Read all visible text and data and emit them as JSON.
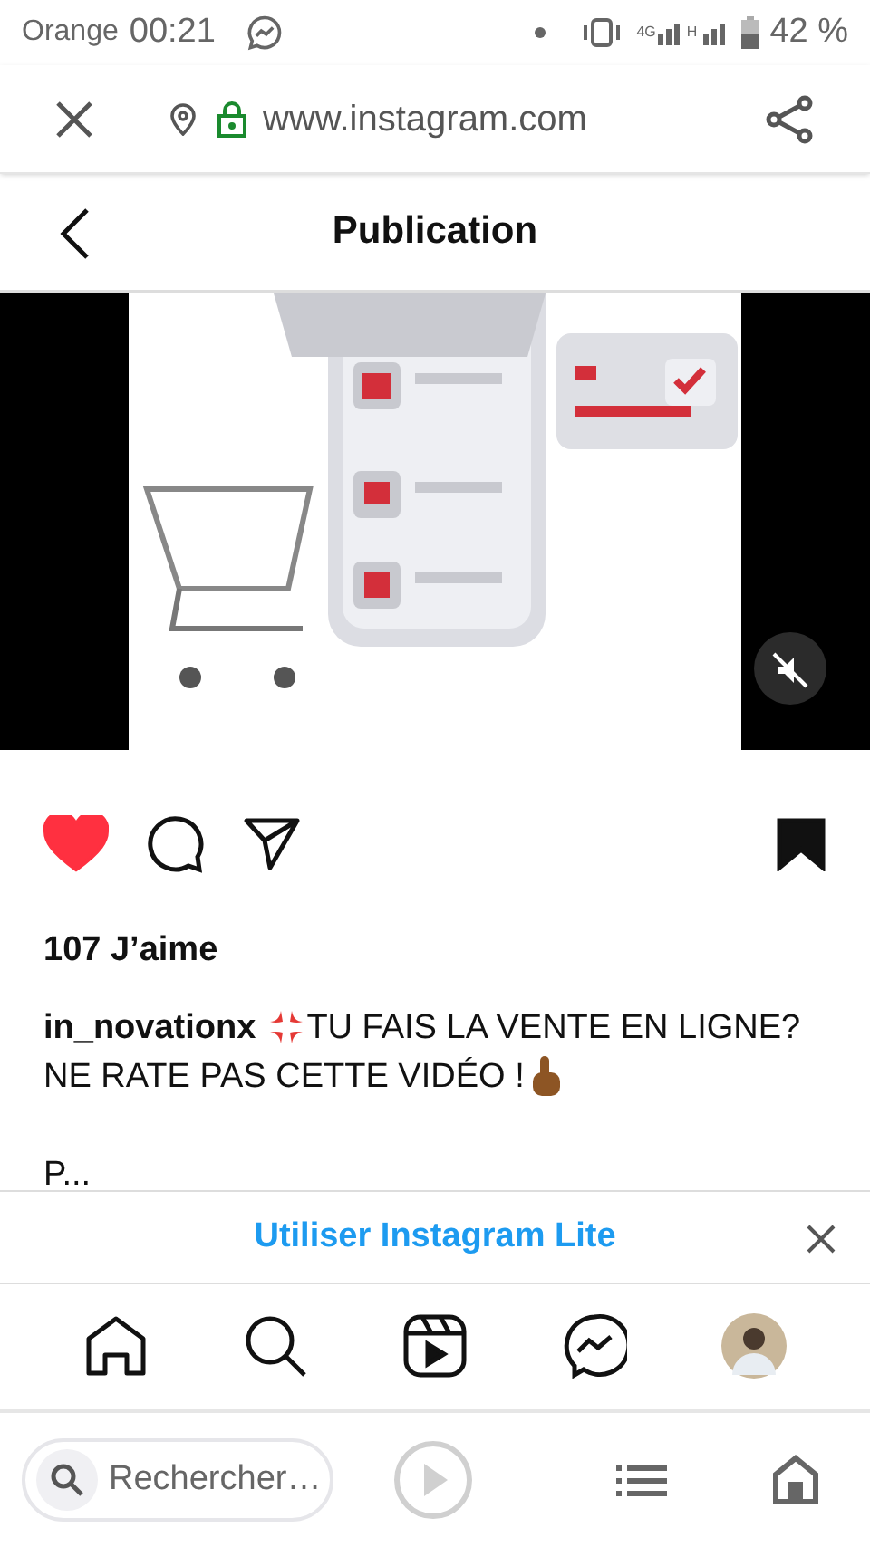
{
  "status_bar": {
    "carrier": "Orange",
    "time": "00:21",
    "network_1": "4G",
    "network_2": "H",
    "battery": "42 %"
  },
  "browser_bar": {
    "url": "www.instagram.com"
  },
  "header": {
    "title": "Publication"
  },
  "post": {
    "media": {
      "kind": "picture",
      "muted": true
    },
    "liked": true,
    "saved": true,
    "likes": "107 J’aime",
    "username": "in_novationx",
    "caption_line_1": "TU FAIS LA VENTE EN LIGNE?",
    "caption_line_2": "NE RATE PAS CETTE VIDÉO !",
    "caption_more": "P..."
  },
  "banner": {
    "label": "Utiliser Instagram Lite"
  },
  "bottom_nav": [
    {
      "kind": "home"
    },
    {
      "kind": "search"
    },
    {
      "kind": "reels"
    },
    {
      "kind": "messenger"
    },
    {
      "kind": "avatar"
    }
  ],
  "browser_toolbar": {
    "search_placeholder": "Rechercher…"
  }
}
